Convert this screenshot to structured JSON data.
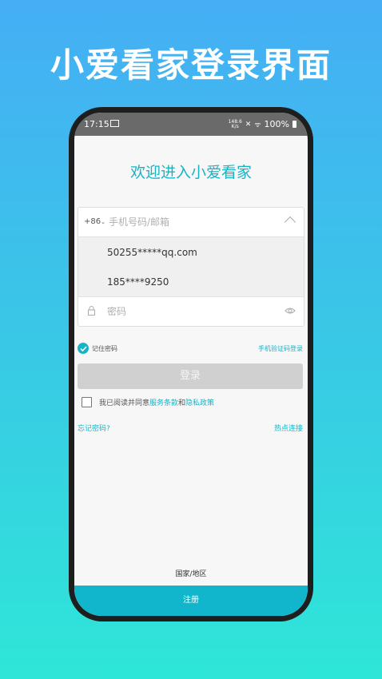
{
  "promo": {
    "title": "小爱看家登录界面"
  },
  "status_bar": {
    "time": "17:15",
    "speed_value": "148.6",
    "speed_unit": "K/s",
    "signal": "ᯤ",
    "battery": "100%"
  },
  "login": {
    "welcome": "欢迎进入小爱看家",
    "country_code": "+86",
    "phone_placeholder": "手机号码/邮箱",
    "saved_accounts": [
      "50255*****qq.com",
      "185****9250"
    ],
    "password_placeholder": "密码",
    "remember_label": "记住密码",
    "sms_login": "手机验证码登录",
    "login_button": "登录",
    "agree_prefix": "我已阅读并同意",
    "terms": "服务条款",
    "and": "和",
    "privacy": "隐私政策",
    "forgot": "忘记密码?",
    "hotspot": "热点连接",
    "region": "国家/地区",
    "register": "注册"
  },
  "colors": {
    "accent": "#19b3c6",
    "register_bar": "#12b6cc",
    "disabled_button": "#d0d0d0"
  }
}
